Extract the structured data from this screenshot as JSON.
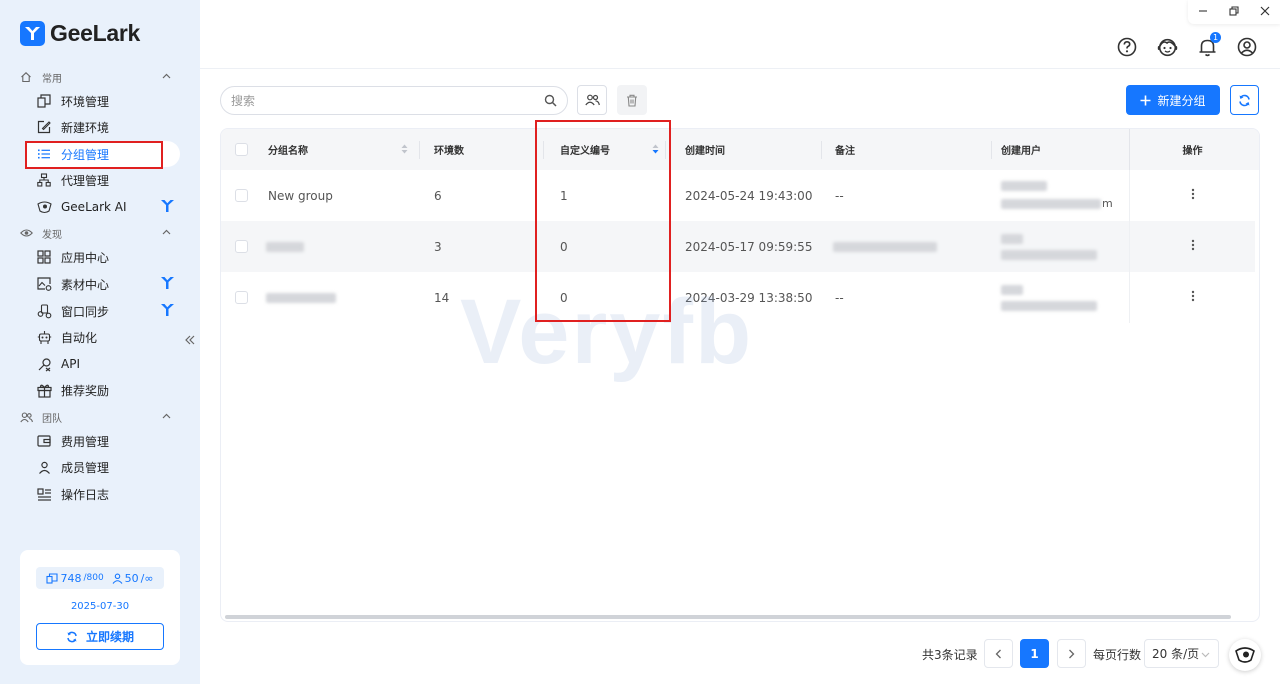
{
  "app": {
    "name": "GeeLark"
  },
  "sidebar": {
    "sections": [
      {
        "label": "常用"
      },
      {
        "label": "发现"
      },
      {
        "label": "团队"
      }
    ],
    "items": [
      {
        "label": "环境管理"
      },
      {
        "label": "新建环境"
      },
      {
        "label": "分组管理"
      },
      {
        "label": "代理管理"
      },
      {
        "label": "GeeLark AI"
      },
      {
        "label": "应用中心"
      },
      {
        "label": "素材中心"
      },
      {
        "label": "窗口同步"
      },
      {
        "label": "自动化"
      },
      {
        "label": "API"
      },
      {
        "label": "推荐奖励"
      },
      {
        "label": "费用管理"
      },
      {
        "label": "成员管理"
      },
      {
        "label": "操作日志"
      }
    ],
    "plan": {
      "env_count": "748",
      "env_limit": "/800",
      "member_count": "50",
      "member_limit": "/∞",
      "expire_date": "2025-07-30",
      "renew_label": "立即续期"
    }
  },
  "topbar": {
    "notification_count": "1"
  },
  "toolbar": {
    "search_placeholder": "搜索",
    "create_label": "新建分组"
  },
  "table": {
    "columns": [
      "分组名称",
      "环境数",
      "自定义编号",
      "创建时间",
      "备注",
      "创建用户",
      "操作"
    ],
    "rows": [
      {
        "name": "New group",
        "env_count": "6",
        "custom_no": "1",
        "created": "2024-05-24 19:43:00",
        "note": "--",
        "user_suffix": "m"
      },
      {
        "name": "",
        "env_count": "3",
        "custom_no": "0",
        "created": "2024-05-17 09:59:55",
        "note": "",
        "user_suffix": ""
      },
      {
        "name": "",
        "env_count": "14",
        "custom_no": "0",
        "created": "2024-03-29 13:38:50",
        "note": "--",
        "user_suffix": ""
      }
    ]
  },
  "watermark": "Veryfb",
  "pagination": {
    "total_label": "共3条记录",
    "current_page": "1",
    "per_page_label": "每页行数",
    "per_page_value": "20 条/页"
  },
  "colors": {
    "accent": "#1677ff",
    "highlight": "#e02020",
    "sidebar_bg": "#e9f1fb"
  }
}
